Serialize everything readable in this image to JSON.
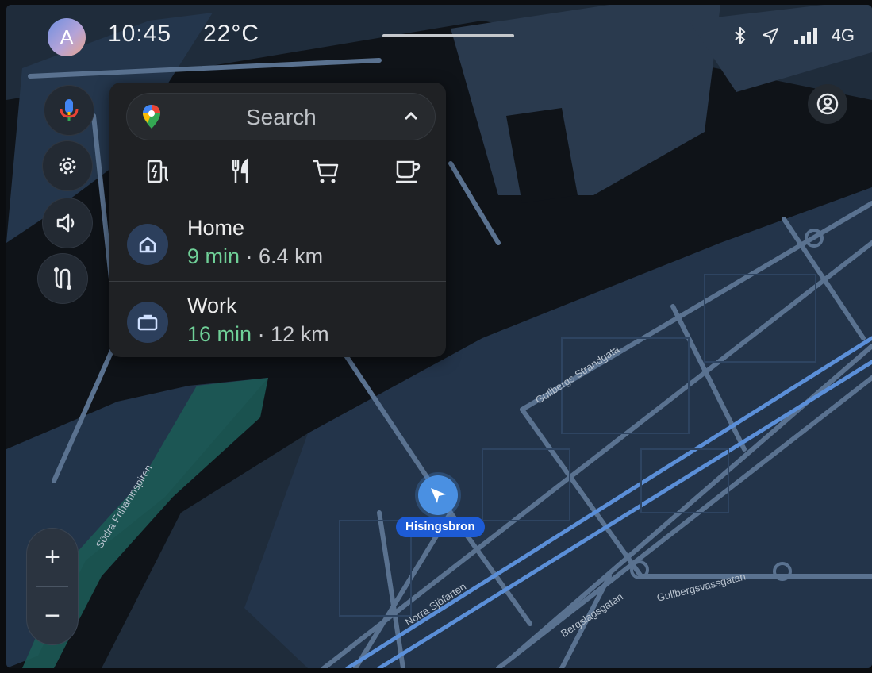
{
  "status_bar": {
    "avatar_letter": "A",
    "time": "10:45",
    "temperature": "22°C",
    "network": "4G",
    "icons": [
      "bluetooth-icon",
      "location-arrow-icon",
      "signal-bars-icon"
    ]
  },
  "side_controls": [
    "microphone-icon",
    "settings-gear-icon",
    "volume-icon",
    "route-options-icon"
  ],
  "search_panel": {
    "search_placeholder": "Search",
    "categories": [
      "ev-charging-icon",
      "restaurants-icon",
      "shopping-cart-icon",
      "coffee-icon"
    ],
    "destinations": [
      {
        "name": "Home",
        "eta": "9 min",
        "distance": "· 6.4 km",
        "icon": "home-icon"
      },
      {
        "name": "Work",
        "eta": "16 min",
        "distance": "· 12 km",
        "icon": "briefcase-icon"
      }
    ]
  },
  "map": {
    "current_location_label": "Hisingsbron",
    "streets": [
      "Gullbergs Strandgata",
      "Södra Frihamnspiren",
      "Norra Sjöfarten",
      "Bergslagsgatan",
      "Gullbergsvassgatan"
    ]
  },
  "zoom": {
    "in_label": "+",
    "out_label": "−"
  },
  "colors": {
    "map_land": "#1f2c3b",
    "water": "#0f1318",
    "road": "#5a7290",
    "route_highlight": "#5b8fd8",
    "eta_green": "#6fcf97",
    "puck": "#4a90e2"
  }
}
